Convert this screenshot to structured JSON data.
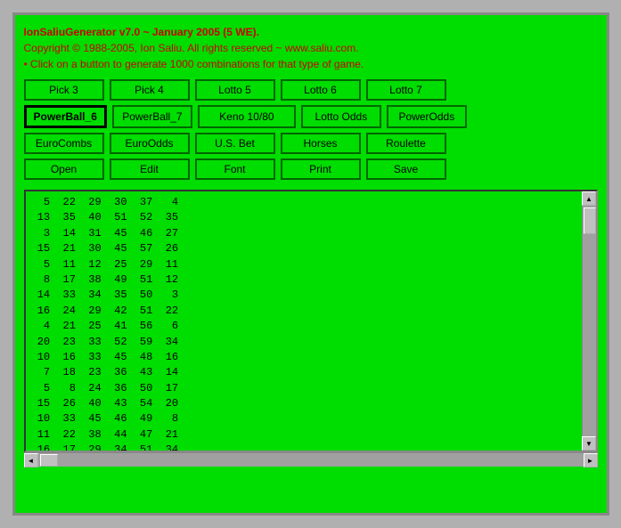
{
  "app": {
    "title": "IonSaliuGenerator v7.0 ~ January 2005 (5 WE).",
    "copyright": "Copyright © 1988-2005, Ion Saliu. All rights reserved ~ www.saliu.com.",
    "instruction": "• Click on a button to generate 1000 combinations for that type of game."
  },
  "buttons": {
    "row1": [
      {
        "label": "Pick 3",
        "name": "pick3"
      },
      {
        "label": "Pick 4",
        "name": "pick4"
      },
      {
        "label": "Lotto 5",
        "name": "lotto5"
      },
      {
        "label": "Lotto 6",
        "name": "lotto6"
      },
      {
        "label": "Lotto 7",
        "name": "lotto7"
      }
    ],
    "row2": [
      {
        "label": "PowerBall_6",
        "name": "powerball6",
        "special": true
      },
      {
        "label": "PowerBall_7",
        "name": "powerball7"
      },
      {
        "label": "Keno 10/80",
        "name": "keno"
      },
      {
        "label": "Lotto Odds",
        "name": "lotto-odds"
      },
      {
        "label": "PowerOdds",
        "name": "powerodds"
      }
    ],
    "row3": [
      {
        "label": "EuroCombs",
        "name": "eurocombs"
      },
      {
        "label": "EuroOdds",
        "name": "euroodds"
      },
      {
        "label": "U.S. Bet",
        "name": "usbet"
      },
      {
        "label": "Horses",
        "name": "horses"
      },
      {
        "label": "Roulette",
        "name": "roulette"
      }
    ],
    "row4": [
      {
        "label": "Open",
        "name": "open"
      },
      {
        "label": "Edit",
        "name": "edit"
      },
      {
        "label": "Font",
        "name": "font"
      },
      {
        "label": "Print",
        "name": "print"
      },
      {
        "label": "Save",
        "name": "save"
      }
    ]
  },
  "output": "  5  22  29  30  37   4\n 13  35  40  51  52  35\n  3  14  31  45  46  27\n 15  21  30  45  57  26\n  5  11  12  25  29  11\n  8  17  38  49  51  12\n 14  33  34  35  50   3\n 16  24  29  42  51  22\n  4  21  25  41  56   6\n 20  23  33  52  59  34\n 10  16  33  45  48  16\n  7  18  23  36  43  14\n  5   8  24  36  50  17\n 15  26  40  43  54  20\n 10  33  45  46  49   8\n 11  22  38  44  47  21\n 16  17  29  34  51  34"
}
